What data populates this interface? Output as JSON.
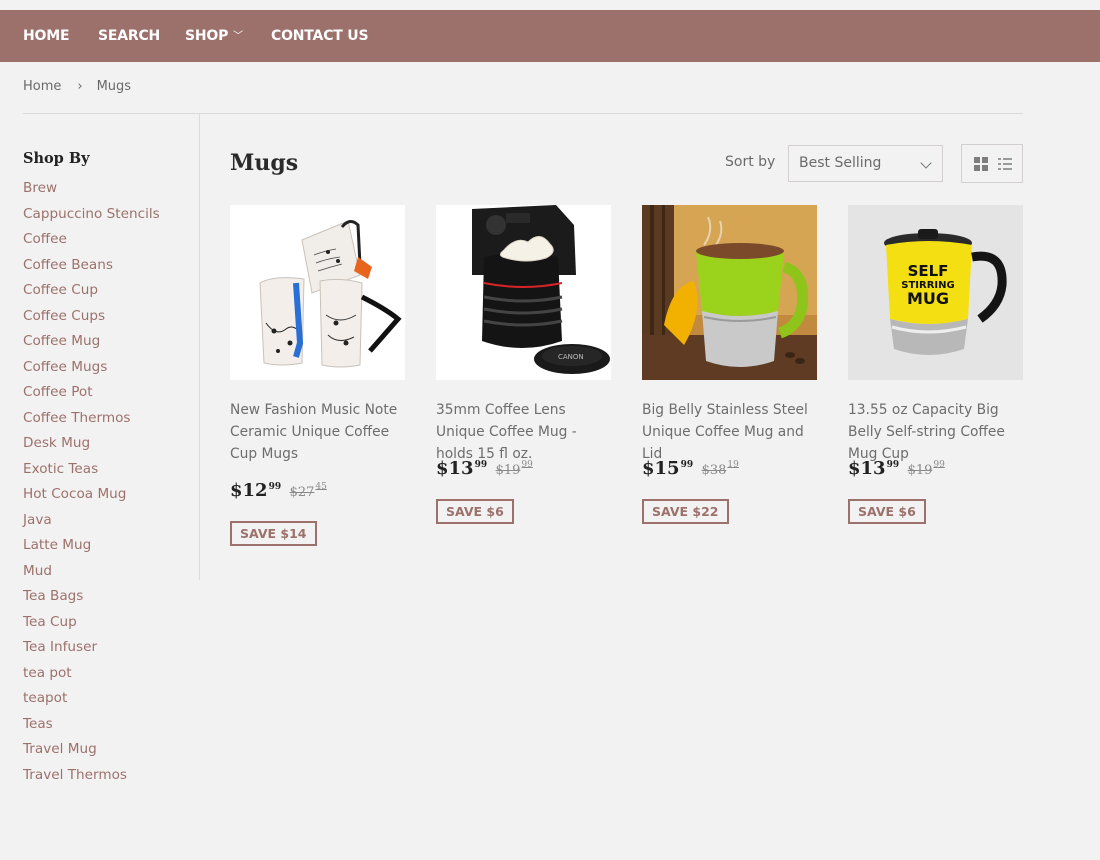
{
  "nav": {
    "home": "HOME",
    "search": "SEARCH",
    "shop": "SHOP",
    "contact": "CONTACT US"
  },
  "breadcrumb": {
    "home": "Home",
    "separator": "›",
    "current": "Mugs"
  },
  "sidebar": {
    "title": "Shop By",
    "items": [
      "Brew",
      "Cappuccino Stencils",
      "Coffee",
      "Coffee Beans",
      "Coffee Cup",
      "Coffee Cups",
      "Coffee Mug",
      "Coffee Mugs",
      "Coffee Pot",
      "Coffee Thermos",
      "Desk Mug",
      "Exotic Teas",
      "Hot Cocoa Mug",
      "Java",
      "Latte Mug",
      "Mud",
      "Tea Bags",
      "Tea Cup",
      "Tea Infuser",
      "tea pot",
      "teapot",
      "Teas",
      "Travel Mug",
      "Travel Thermos"
    ]
  },
  "page": {
    "title": "Mugs",
    "sort_label": "Sort by",
    "sort_value": "Best Selling"
  },
  "products": [
    {
      "title": "New Fashion Music Note Ceramic Unique Coffee Cup Mugs",
      "price_main": "$12",
      "price_cents": "99",
      "old_main": "$27",
      "old_cents": "45",
      "save": "SAVE $14"
    },
    {
      "title": "35mm Coffee Lens Unique Coffee Mug - holds 15 fl oz.",
      "price_main": "$13",
      "price_cents": "99",
      "old_main": "$19",
      "old_cents": "99",
      "save": "SAVE $6"
    },
    {
      "title": "Big Belly Stainless Steel Unique Coffee Mug and Lid",
      "price_main": "$15",
      "price_cents": "99",
      "old_main": "$38",
      "old_cents": "19",
      "save": "SAVE $22"
    },
    {
      "title": "13.55 oz Capacity Big Belly Self-string Coffee Mug Cup",
      "price_main": "$13",
      "price_cents": "99",
      "old_main": "$19",
      "old_cents": "99",
      "save": "SAVE $6"
    }
  ],
  "product_image_text": {
    "self": "SELF",
    "stirring": "STIRRING",
    "mug": "MUG",
    "lens_cap": "CANON"
  },
  "colors": {
    "nav_bg": "#9c716b",
    "accent": "#9c716b",
    "page_bg": "#f3f2f2"
  }
}
